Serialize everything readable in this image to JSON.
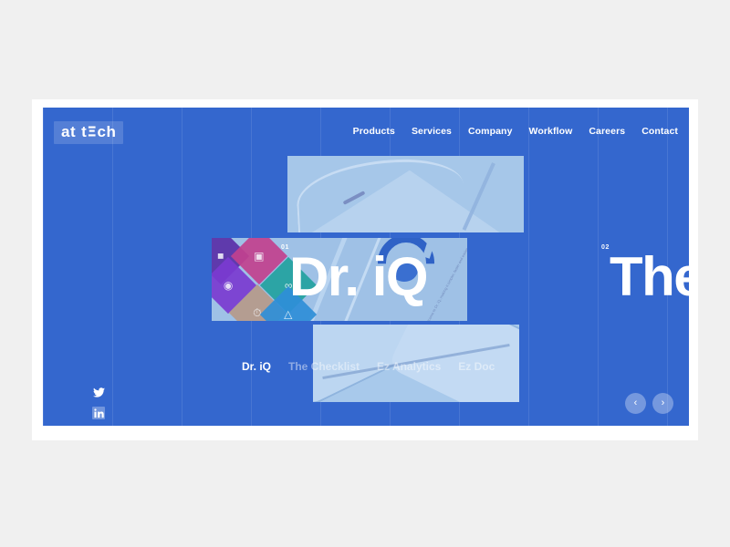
{
  "page": {
    "canvas_bg": "#f0f0f0",
    "frame_bg": "#ffffff",
    "hero_bg": "#3467ce",
    "accent_light": "#a6c7e9"
  },
  "header": {
    "logo": {
      "part_a": "at",
      "part_b": "t",
      "part_e": "Ξ",
      "part_c": "ch",
      "full_text": "at tech"
    },
    "nav": [
      {
        "label": "Products"
      },
      {
        "label": "Services"
      },
      {
        "label": "Company"
      },
      {
        "label": "Workflow"
      },
      {
        "label": "Careers"
      },
      {
        "label": "Contact"
      }
    ]
  },
  "slider": {
    "slides": [
      {
        "number": "01",
        "title": "Dr. iQ"
      },
      {
        "number": "02",
        "title": "The"
      }
    ],
    "tabs": [
      {
        "label": "Dr. iQ",
        "active": true
      },
      {
        "label": "The Checklist",
        "active": false
      },
      {
        "label": "Ez Analytics",
        "active": false
      },
      {
        "label": "Ez Doc",
        "active": false
      }
    ],
    "controls": {
      "prev_icon": "‹",
      "next_icon": "›",
      "prev_name": "previous-slide",
      "next_name": "next-slide"
    },
    "micro_copy": "Welcome to Dr. iQ, making it simpler, faster and easier"
  },
  "socials": [
    {
      "name": "twitter-icon",
      "label": "Twitter"
    },
    {
      "name": "linkedin-icon",
      "label": "LinkedIn"
    }
  ]
}
